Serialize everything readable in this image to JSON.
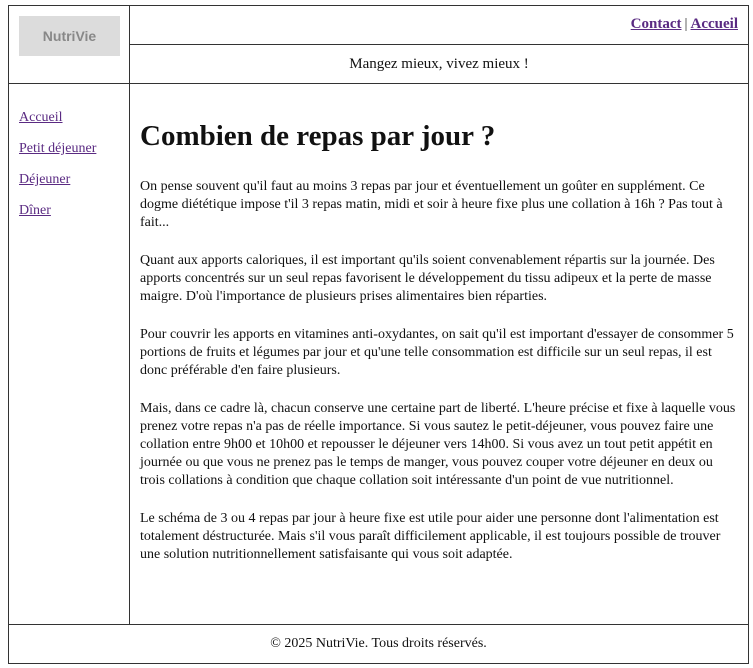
{
  "brand": {
    "logo_text": "NutriVie"
  },
  "top_nav": {
    "contact": "Contact",
    "separator": "|",
    "home": "Accueil"
  },
  "slogan": "Mangez mieux, vivez mieux !",
  "sidebar": {
    "items": [
      {
        "label": "Accueil"
      },
      {
        "label": "Petit déjeuner"
      },
      {
        "label": "Déjeuner"
      },
      {
        "label": "Dîner"
      }
    ]
  },
  "article": {
    "title": "Combien de repas par jour ?",
    "paragraphs": [
      "On pense souvent qu'il faut au moins 3 repas par jour et éventuellement un goûter en supplément. Ce dogme diététique impose t'il 3 repas matin, midi et soir à heure fixe plus une collation à 16h ? Pas tout à fait...",
      "Quant aux apports caloriques, il est important qu'ils soient convenablement répartis sur la journée. Des apports concentrés sur un seul repas favorisent le développement du tissu adipeux et la perte de masse maigre. D'où l'importance de plusieurs prises alimentaires bien réparties.",
      "Pour couvrir les apports en vitamines anti-oxydantes, on sait qu'il est important d'essayer de consommer 5 portions de fruits et légumes par jour et qu'une telle consommation est difficile sur un seul repas, il est donc préférable d'en faire plusieurs.",
      "Mais, dans ce cadre là, chacun conserve une certaine part de liberté. L'heure précise et fixe à laquelle vous prenez votre repas n'a pas de réelle importance. Si vous sautez le petit-déjeuner, vous pouvez faire une collation entre 9h00 et 10h00 et repousser le déjeuner vers 14h00. Si vous avez un tout petit appétit en journée ou que vous ne prenez pas le temps de manger, vous pouvez couper votre déjeuner en deux ou trois collations à condition que chaque collation soit intéressante d'un point de vue nutritionnel.",
      "Le schéma de 3 ou 4 repas par jour à heure fixe est utile pour aider une personne dont l'alimentation est totalement déstructurée. Mais s'il vous paraît difficilement applicable, il est toujours possible de trouver une solution nutritionnellement satisfaisante qui vous soit adaptée."
    ]
  },
  "footer": {
    "text": "© 2025 NutriVie. Tous droits réservés."
  }
}
